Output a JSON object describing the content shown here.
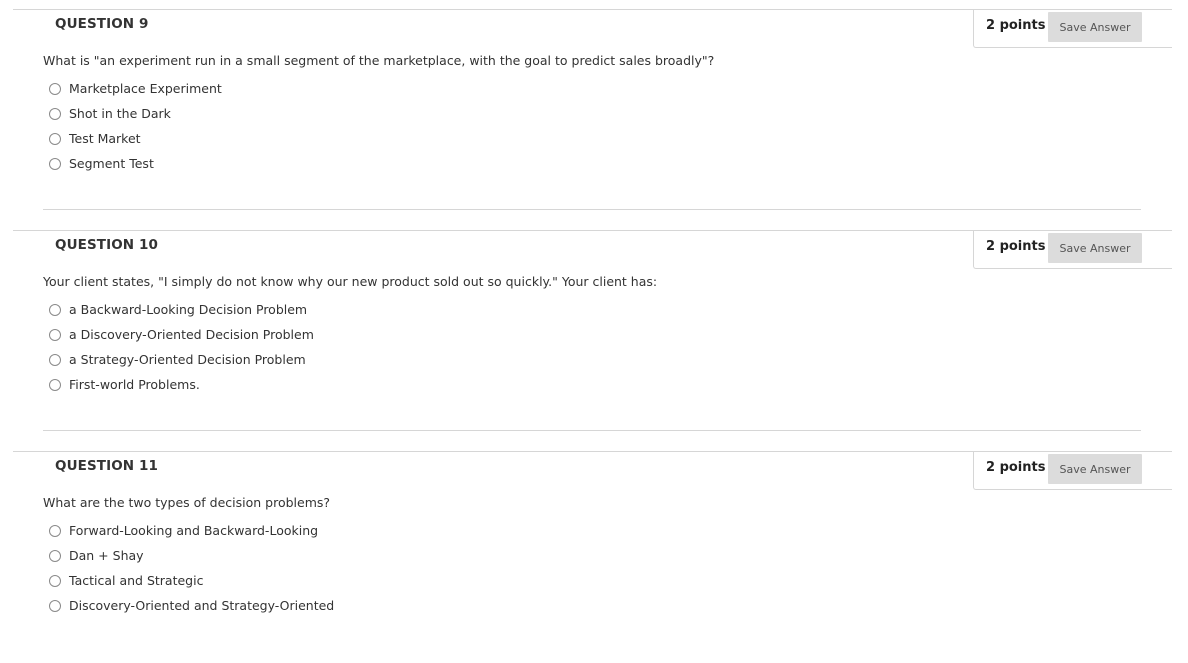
{
  "questions": [
    {
      "title": "QUESTION 9",
      "points": "2 points",
      "save_label": "Save Answer",
      "prompt": "What is \"an experiment run in a small segment of the marketplace, with the goal to predict sales broadly\"?",
      "options": [
        "Marketplace Experiment",
        "Shot in the Dark",
        "Test Market",
        "Segment Test"
      ]
    },
    {
      "title": "QUESTION 10",
      "points": "2 points",
      "save_label": "Save Answer",
      "prompt": "Your client states, \"I simply do not know why our new product sold out so quickly.\" Your client has:",
      "options": [
        "a Backward-Looking Decision Problem",
        "a Discovery-Oriented Decision Problem",
        "a Strategy-Oriented Decision Problem",
        "First-world Problems."
      ]
    },
    {
      "title": "QUESTION 11",
      "points": "2 points",
      "save_label": "Save Answer",
      "prompt": "What are the two types of decision problems?",
      "options": [
        "Forward-Looking and Backward-Looking",
        "Dan + Shay",
        "Tactical and Strategic",
        "Discovery-Oriented and Strategy-Oriented"
      ]
    }
  ]
}
